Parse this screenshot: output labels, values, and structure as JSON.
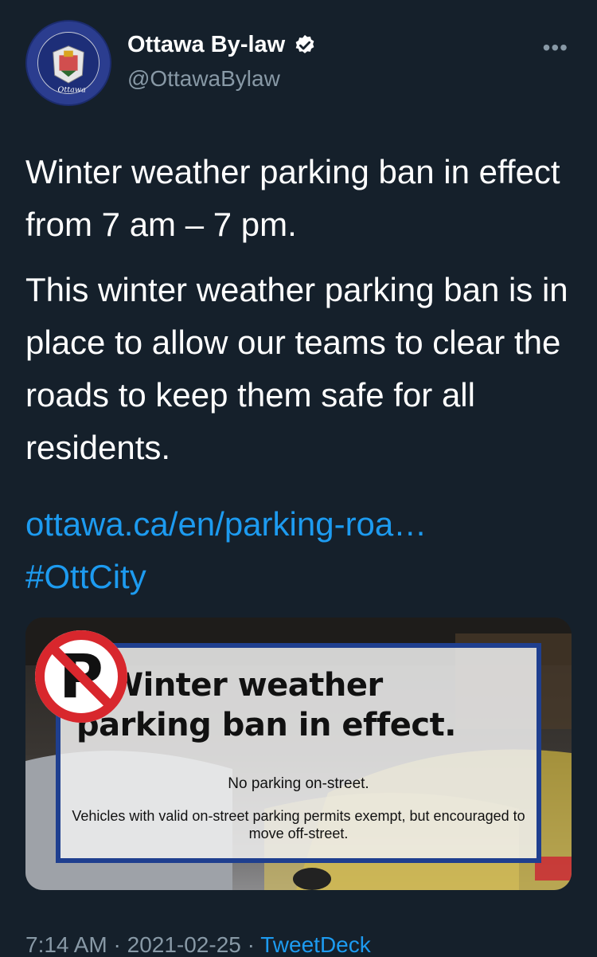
{
  "author": {
    "name": "Ottawa By-law",
    "handle": "@OttawaBylaw",
    "verified": true,
    "avatar_icon": "ottawa-bylaw-badge"
  },
  "tweet": {
    "paragraphs": [
      "Winter weather parking ban in effect from 7 am – 7 pm.",
      "This winter weather parking ban is in place to allow our teams to clear the roads to keep them safe for all residents."
    ],
    "link": "ottawa.ca/en/parking-roa…",
    "hashtag": "#OttCity"
  },
  "media": {
    "headline_line1": "Winter weather",
    "headline_line2": "parking ban in effect.",
    "note1": "No parking on-street.",
    "note2": "Vehicles with valid on-street parking permits exempt, but encouraged to move off-street."
  },
  "meta": {
    "time": "7:14 AM",
    "date": "2021-02-25",
    "separator": "·",
    "via": "TweetDeck"
  },
  "colors": {
    "background": "#15202b",
    "link": "#1d9bf0",
    "secondary_text": "#8899a6",
    "sign_border": "#1f3f8f",
    "no_parking_red": "#d8272d"
  }
}
